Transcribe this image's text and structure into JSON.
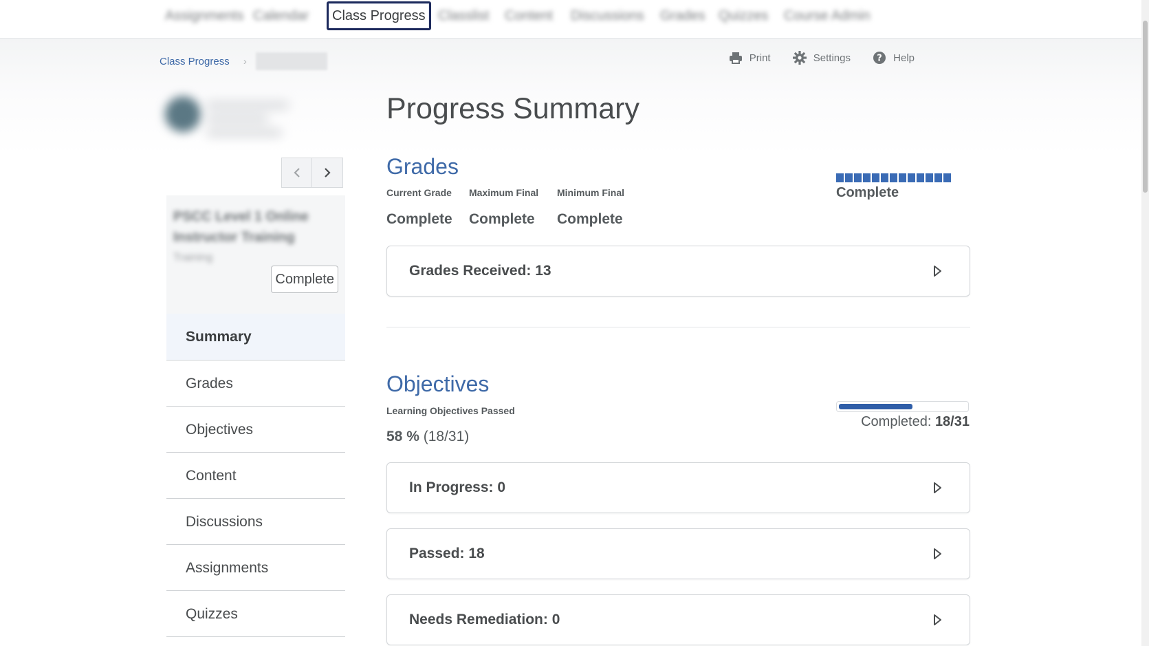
{
  "top_nav": {
    "items": [
      {
        "label": "Assignments",
        "blurred": true
      },
      {
        "label": "Calendar",
        "blurred": true
      },
      {
        "label": "Class Progress",
        "blurred": false,
        "active": true
      },
      {
        "label": "Classlist",
        "blurred": true
      },
      {
        "label": "Content",
        "blurred": true
      },
      {
        "label": "Discussions",
        "blurred": true
      },
      {
        "label": "Grades",
        "blurred": true
      },
      {
        "label": "Quizzes",
        "blurred": true
      },
      {
        "label": "Course Admin",
        "blurred": true
      }
    ]
  },
  "breadcrumb": {
    "link": "Class Progress",
    "separator": "›"
  },
  "toolbar": {
    "print": "Print",
    "settings": "Settings",
    "help": "Help"
  },
  "sidebar": {
    "course_name_line1": "PSCC Level 1 Online",
    "course_name_line2": "Instructor Training",
    "course_type": "Training",
    "course_status": "Complete",
    "menu": [
      {
        "label": "Summary",
        "active": true
      },
      {
        "label": "Grades"
      },
      {
        "label": "Objectives"
      },
      {
        "label": "Content"
      },
      {
        "label": "Discussions"
      },
      {
        "label": "Assignments"
      },
      {
        "label": "Quizzes"
      }
    ]
  },
  "main": {
    "title": "Progress Summary",
    "grades": {
      "title": "Grades",
      "current_grade_label": "Current Grade",
      "current_grade_value": "Complete",
      "maximum_final_label": "Maximum Final",
      "maximum_final_value": "Complete",
      "minimum_final_label": "Minimum Final",
      "minimum_final_value": "Complete",
      "indicator_block_count": 13,
      "indicator_caption": "Complete",
      "accordion": "Grades Received: 13"
    },
    "objectives": {
      "title": "Objectives",
      "label": "Learning Objectives Passed",
      "percent": "58 %",
      "fraction": "(18/31)",
      "progress_fraction": 0.58,
      "progress_caption_label": "Completed:",
      "progress_caption_value": "18/31",
      "accordions": [
        "In Progress: 0",
        "Passed: 18",
        "Needs Remediation: 0"
      ]
    }
  },
  "colors": {
    "accent": "#3f6aa8",
    "bar": "#2f5ea8",
    "focus_ring": "#1d2a5c"
  }
}
